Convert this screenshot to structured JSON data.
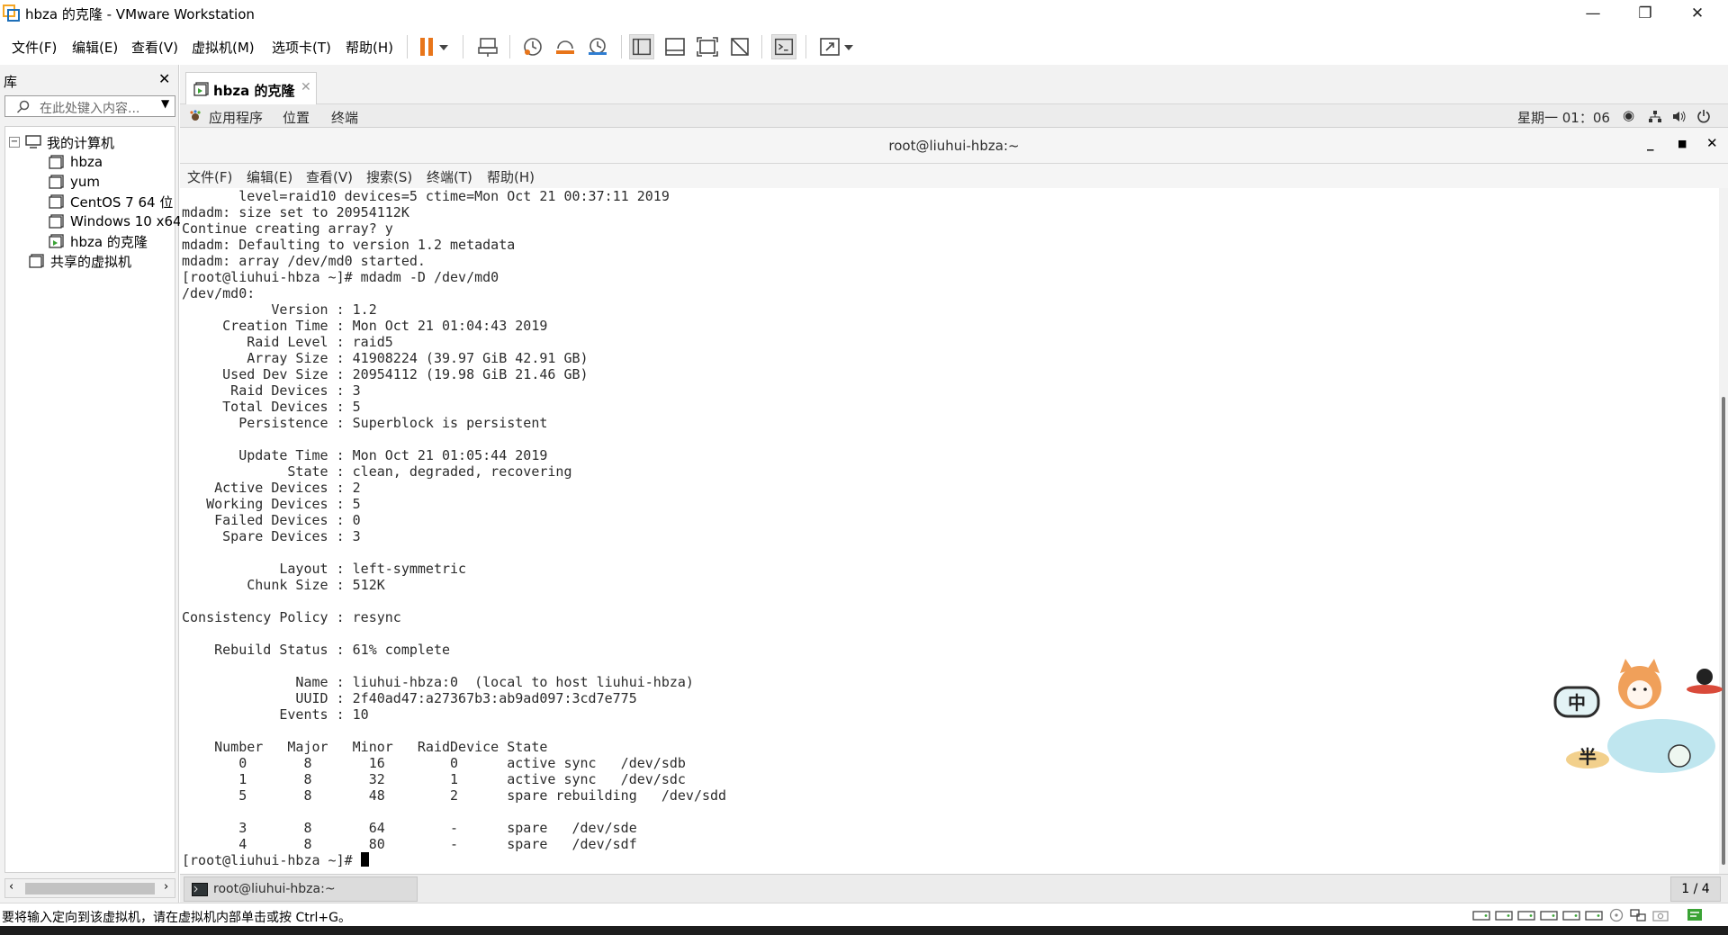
{
  "window": {
    "title": "hbza 的克隆 - VMware Workstation"
  },
  "menubar": {
    "items": [
      "文件(F)",
      "编辑(E)",
      "查看(V)",
      "虚拟机(M)",
      "选项卡(T)",
      "帮助(H)"
    ]
  },
  "library": {
    "title": "库",
    "search_placeholder": "在此处键入内容...",
    "tree": {
      "root": "我的计算机",
      "vms": [
        "hbza",
        "yum",
        "CentOS 7 64 位",
        "Windows 10 x64",
        "hbza 的克隆"
      ],
      "shared": "共享的虚拟机"
    }
  },
  "tab": {
    "label": "hbza 的克隆"
  },
  "gnome": {
    "apps": "应用程序",
    "places": "位置",
    "terminal": "终端",
    "clock": "星期一 01：06"
  },
  "terminal": {
    "title": "root@liuhui-hbza:~",
    "menu": [
      "文件(F)",
      "编辑(E)",
      "查看(V)",
      "搜索(S)",
      "终端(T)",
      "帮助(H)"
    ],
    "lines": [
      "       level=raid10 devices=5 ctime=Mon Oct 21 00:37:11 2019",
      "mdadm: size set to 20954112K",
      "Continue creating array? y",
      "mdadm: Defaulting to version 1.2 metadata",
      "mdadm: array /dev/md0 started.",
      "[root@liuhui-hbza ~]# mdadm -D /dev/md0",
      "/dev/md0:",
      "           Version : 1.2",
      "     Creation Time : Mon Oct 21 01:04:43 2019",
      "        Raid Level : raid5",
      "        Array Size : 41908224 (39.97 GiB 42.91 GB)",
      "     Used Dev Size : 20954112 (19.98 GiB 21.46 GB)",
      "      Raid Devices : 3",
      "     Total Devices : 5",
      "       Persistence : Superblock is persistent",
      "",
      "       Update Time : Mon Oct 21 01:05:44 2019",
      "             State : clean, degraded, recovering",
      "    Active Devices : 2",
      "   Working Devices : 5",
      "    Failed Devices : 0",
      "     Spare Devices : 3",
      "",
      "            Layout : left-symmetric",
      "        Chunk Size : 512K",
      "",
      "Consistency Policy : resync",
      "",
      "    Rebuild Status : 61% complete",
      "",
      "              Name : liuhui-hbza:0  (local to host liuhui-hbza)",
      "              UUID : 2f40ad47:a27367b3:ab9ad097:3cd7e775",
      "            Events : 10",
      "",
      "    Number   Major   Minor   RaidDevice State",
      "       0       8       16        0      active sync   /dev/sdb",
      "       1       8       32        1      active sync   /dev/sdc",
      "       5       8       48        2      spare rebuilding   /dev/sdd",
      "",
      "       3       8       64        -      spare   /dev/sde",
      "       4       8       80        -      spare   /dev/sdf"
    ],
    "prompt": "[root@liuhui-hbza ~]# "
  },
  "taskbar": {
    "item": "root@liuhui-hbza:~",
    "workspace": "1 / 4"
  },
  "status": {
    "message": "要将输入定向到该虚拟机，请在虚拟机内部单击或按 Ctrl+G。"
  },
  "ime": {
    "mode": "中",
    "width": "半"
  },
  "colors": {
    "pause": "#e8751a",
    "selection": "#cce8ff",
    "accent": "#2f7dd1"
  }
}
